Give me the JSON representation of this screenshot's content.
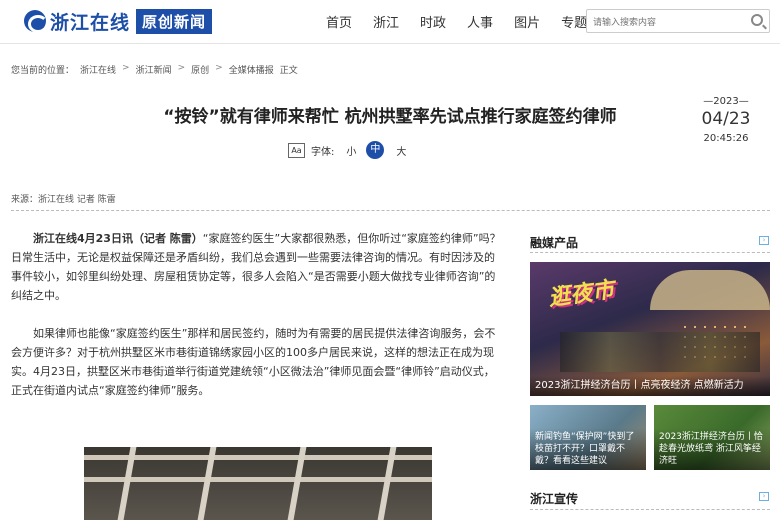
{
  "header": {
    "logo_text": "浙江在线",
    "logo_badge": "原创新闻",
    "nav": [
      "首页",
      "浙江",
      "时政",
      "人事",
      "图片",
      "专题"
    ],
    "search_placeholder": "请输入搜索内容"
  },
  "breadcrumb": {
    "prefix": "您当前的位置：",
    "items": [
      "浙江在线",
      "浙江新闻",
      "原创",
      "全媒体播报",
      "正文"
    ],
    "separator": ">"
  },
  "article": {
    "title": "“按铃”就有律师来帮忙 杭州拱墅率先试点推行家庭签约律师",
    "font_size": {
      "icon": "Aa",
      "label": "字体:",
      "options": [
        "小",
        "中",
        "大"
      ],
      "selected": "中"
    },
    "date": {
      "year": "—2023—",
      "month_day": "04/23",
      "time": "20:45:26"
    },
    "source": "来源：浙江在线   记者 陈雷",
    "lead": "浙江在线4月23日讯（记者 陈雷）",
    "paragraph1": "“家庭签约医生”大家都很熟悉，但你听过“家庭签约律师”吗？日常生活中，无论是权益保障还是矛盾纠纷，我们总会遇到一些需要法律咨询的情况。有时因涉及的事件较小，如邻里纠纷处理、房屋租赁协定等，很多人会陷入“是否需要小题大做找专业律师咨询”的纠结之中。",
    "paragraph2": "如果律师也能像“家庭签约医生”那样和居民签约，随时为有需要的居民提供法律咨询服务，会不会方便许多？对于杭州拱墅区米市巷街道锦绣家园小区的100多户居民来说，这样的想法正在成为现实。4月23日，拱墅区米市巷街道举行街道党建统领“小区微法治”律师见面会暨“律师铃”启动仪式，正式在街道内试点“家庭签约律师”服务。"
  },
  "sidebar": {
    "media_heading": "融媒产品",
    "cards": [
      {
        "caption": "2023浙江拼经济台历丨点亮夜经济 点燃新活力",
        "banner": "逛夜市"
      },
      {
        "caption": "新闻钓鱼“保护网”快到了 枝苗打不开？口罩戴不戴？看看这些建议"
      },
      {
        "caption": "2023浙江拼经济台历丨恰趁春光放纸鸢 浙江风筝经济旺"
      }
    ],
    "promo_heading": "浙江宣传"
  },
  "colors": {
    "brand": "#1d4fa8",
    "text": "#333333"
  }
}
